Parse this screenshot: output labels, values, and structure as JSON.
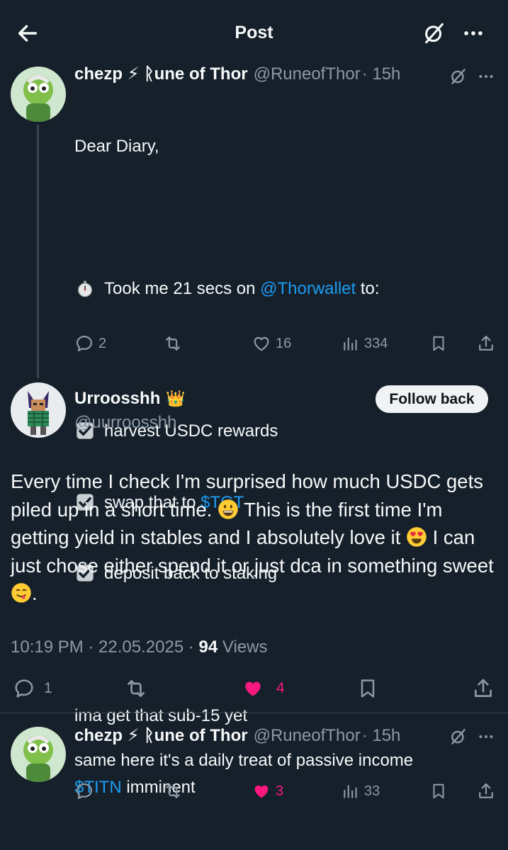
{
  "header": {
    "title": "Post"
  },
  "reply_parent": {
    "author_name": "chezp ⚡ ᚱune of Thor",
    "handle": "@RuneofThor",
    "time": "· 15h",
    "lines": {
      "l1": "Dear Diary,",
      "l2_pre": "Took me 21 secs on ",
      "l2_link": "@Thorwallet",
      "l2_post": " to:",
      "l3": "harvest USDC rewards",
      "l4_pre": "swap that to ",
      "l4_link": "$TGT",
      "l5": "deposit back to staking",
      "l6": "ima get that sub-15 yet",
      "l7_link": "$TITN",
      "l7_post": " imminent"
    },
    "actions": {
      "replies": "2",
      "likes": "16",
      "views": "334"
    }
  },
  "main_post": {
    "author_name": "Urroosshh",
    "author_emoji": "👑",
    "handle": "@uurroosshh",
    "follow_label": "Follow back",
    "text": {
      "p1": "Every time I check I'm surprised how much USDC gets piled up in a short time. ",
      "p2": " This is the first time I'm getting yield in stables and I absolutely love it ",
      "p3": " I can just chose either spend it or just dca in something sweet ",
      "p4": "."
    },
    "meta": {
      "time": "10:19 PM · 22.05.2025 · ",
      "views_count": "94",
      "views_label": " Views"
    },
    "actions": {
      "replies": "1",
      "likes": "4"
    },
    "like_color": "#f91880"
  },
  "reply": {
    "author_name": "chezp ⚡ ᚱune of Thor",
    "handle": "@RuneofThor",
    "time": "· 15h",
    "text": "same here it's a daily treat of passive income",
    "actions": {
      "likes": "3",
      "views": "33"
    }
  },
  "colors": {
    "background": "#15202b",
    "accent": "#1d9bf0",
    "muted": "#8b98a5",
    "like": "#f91880"
  }
}
